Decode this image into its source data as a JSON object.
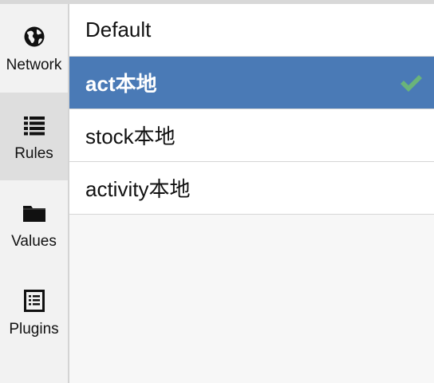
{
  "sidebar": {
    "items": [
      {
        "label": "Network",
        "icon": "globe-icon",
        "active": false
      },
      {
        "label": "Rules",
        "icon": "list-icon",
        "active": true
      },
      {
        "label": "Values",
        "icon": "folder-icon",
        "active": false
      },
      {
        "label": "Plugins",
        "icon": "plugin-list-icon",
        "active": false
      }
    ]
  },
  "rules": {
    "items": [
      {
        "label": "Default",
        "selected": false
      },
      {
        "label": "act本地",
        "selected": true,
        "checked": true
      },
      {
        "label": "stock本地",
        "selected": false
      },
      {
        "label": "activity本地",
        "selected": false
      }
    ]
  },
  "colors": {
    "selected_row_bg": "#4a7ab6",
    "check_color": "#6ab47a",
    "active_nav_bg": "#dedede"
  }
}
